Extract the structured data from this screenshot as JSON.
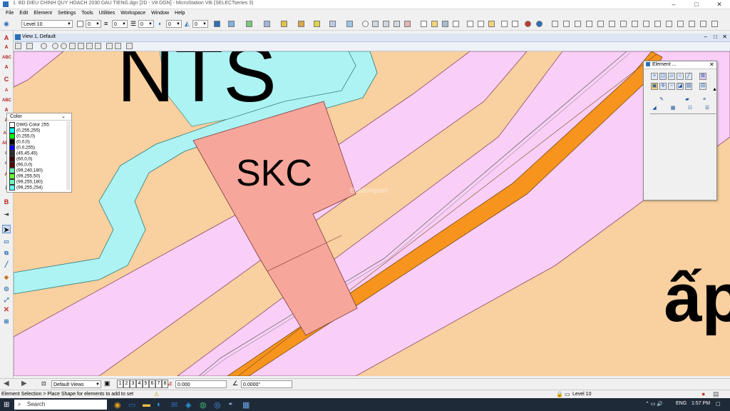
{
  "window": {
    "title": "1. BD DIEU CHINH QUY HOACH 2030 DAU TIENG.dgn [2D - V8 DGN] - MicroStation V8i (SELECTseries 3)",
    "minimize": "–",
    "maximize": "□",
    "close": "✕"
  },
  "menu": [
    "File",
    "Edit",
    "Element",
    "Settings",
    "Tools",
    "Utilities",
    "Workspace",
    "Window",
    "Help"
  ],
  "attributes": {
    "level": "Level 10",
    "color_value": "0",
    "style_value": "0",
    "weight_value": "0",
    "transparency_value": "0",
    "priority_value": "0"
  },
  "view": {
    "title": "View 1, Default"
  },
  "map": {
    "labels": {
      "nts": "NTS",
      "skc": "SKC",
      "ap": "ấp"
    },
    "watermark": "Batdongsan",
    "colors": {
      "background": "#f9d09f",
      "pink_zone": "#f9cff7",
      "skc_parcel": "#f6a69a",
      "water": "#aef3f3",
      "road": "#f7941d"
    }
  },
  "element_palette": {
    "title": "Element ...",
    "color_header": "Color",
    "colors": [
      {
        "label": "DWG Color 255",
        "hex": "#ffffff"
      },
      {
        "label": "(0,255,255)",
        "hex": "#00ffff"
      },
      {
        "label": "(0,255,0)",
        "hex": "#00ff00"
      },
      {
        "label": "(0,0,0)",
        "hex": "#000000"
      },
      {
        "label": "(0,0,255)",
        "hex": "#0000ff"
      },
      {
        "label": "(45,45,45)",
        "hex": "#2d2d2d"
      },
      {
        "label": "(60,0,0)",
        "hex": "#3c0000"
      },
      {
        "label": "(90,0,0)",
        "hex": "#5a0000"
      },
      {
        "label": "(99,240,180)",
        "hex": "#63f0b4"
      },
      {
        "label": "(99,255,50)",
        "hex": "#63ff32"
      },
      {
        "label": "(99,255,180)",
        "hex": "#63ffb4"
      },
      {
        "label": "(99,255,254)",
        "hex": "#63fffe"
      }
    ]
  },
  "bottom": {
    "views_combo": "Default Views",
    "view_numbers": [
      "1",
      "2",
      "3",
      "4",
      "5",
      "6",
      "7",
      "8"
    ],
    "coord_value": "0.000",
    "angle_value": "0.0000°"
  },
  "status": {
    "message": "Element Selection > Place Shape for elements to add to set",
    "level": "Level 10"
  },
  "taskbar": {
    "search_placeholder": "Search",
    "lang": "ENG",
    "time": "1:57 PM"
  }
}
